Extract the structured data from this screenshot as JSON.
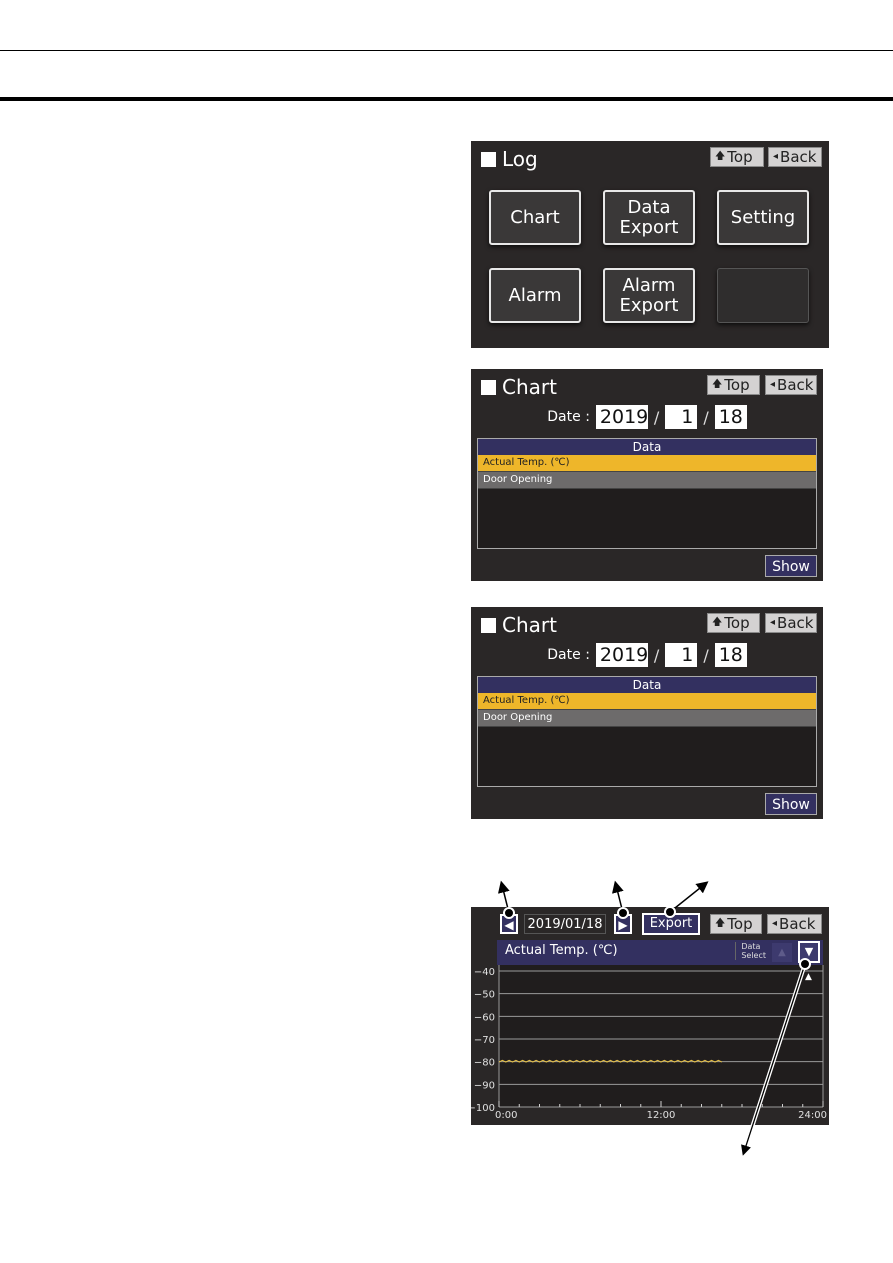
{
  "log_screen": {
    "title": "Log",
    "nav": {
      "top": "Top",
      "back": "Back",
      "top_icon": "up-arrow-icon",
      "back_icon": "left-triangle-icon"
    },
    "buttons": [
      {
        "label": "Chart"
      },
      {
        "label": "Data\nExport"
      },
      {
        "label": "Setting"
      },
      {
        "label": "Alarm"
      },
      {
        "label": "Alarm\nExport"
      },
      {
        "label": ""
      }
    ]
  },
  "chart_screens": [
    {
      "title": "Chart",
      "nav": {
        "top": "Top",
        "back": "Back"
      },
      "date_label": "Date :",
      "date": {
        "year": "2019",
        "month": "1",
        "day": "18",
        "separator": "/"
      },
      "data_header": "Data",
      "data_items": [
        {
          "label": "Actual Temp. (℃)",
          "selected": true
        },
        {
          "label": "Door Opening",
          "selected": false
        }
      ],
      "show_label": "Show"
    },
    {
      "title": "Chart",
      "nav": {
        "top": "Top",
        "back": "Back"
      },
      "date_label": "Date :",
      "date": {
        "year": "2019",
        "month": "1",
        "day": "18",
        "separator": "/"
      },
      "data_header": "Data",
      "data_items": [
        {
          "label": "Actual Temp. (℃)",
          "selected": true
        },
        {
          "label": "Door Opening",
          "selected": false
        }
      ],
      "show_label": "Show"
    }
  ],
  "graph_screen": {
    "prev_icon": "◀",
    "next_icon": "▶",
    "date": "2019/01/18",
    "export_label": "Export",
    "nav": {
      "top": "Top",
      "back": "Back"
    },
    "header_title": "Actual Temp. (℃)",
    "data_select_label": "Data\nSelect",
    "up_icon": "▲",
    "down_icon": "▼",
    "cursor_icon": "▲"
  },
  "colors": {
    "screen_bg": "#2a2727",
    "header_navy": "#333060",
    "selected_row": "#eeb62a",
    "unselected_row": "#6d6b6b",
    "trace": "#e8c040"
  },
  "chart_data": {
    "type": "line",
    "title": "Actual Temp. (℃)",
    "xlabel": "",
    "ylabel": "",
    "x_tick_labels": [
      "0:00",
      "12:00",
      "24:00"
    ],
    "x_range_hours": [
      0,
      24
    ],
    "x_minor_tick_hours": [
      0,
      1.5,
      3,
      4.5,
      6,
      7.5,
      9,
      10.5,
      12,
      13.5,
      15,
      16.5,
      18,
      19.5,
      21,
      22.5,
      24
    ],
    "y_tick_labels": [
      "-40",
      "-50",
      "-60",
      "-70",
      "-80",
      "-90",
      "-100"
    ],
    "ylim": [
      -100,
      -40
    ],
    "grid": true,
    "series": [
      {
        "name": "Actual Temp. (℃)",
        "x_start_hours": 0,
        "x_end_hours": 16.5,
        "baseline": -80,
        "oscillation_amplitude": 0.6,
        "cycles": 33
      }
    ]
  }
}
